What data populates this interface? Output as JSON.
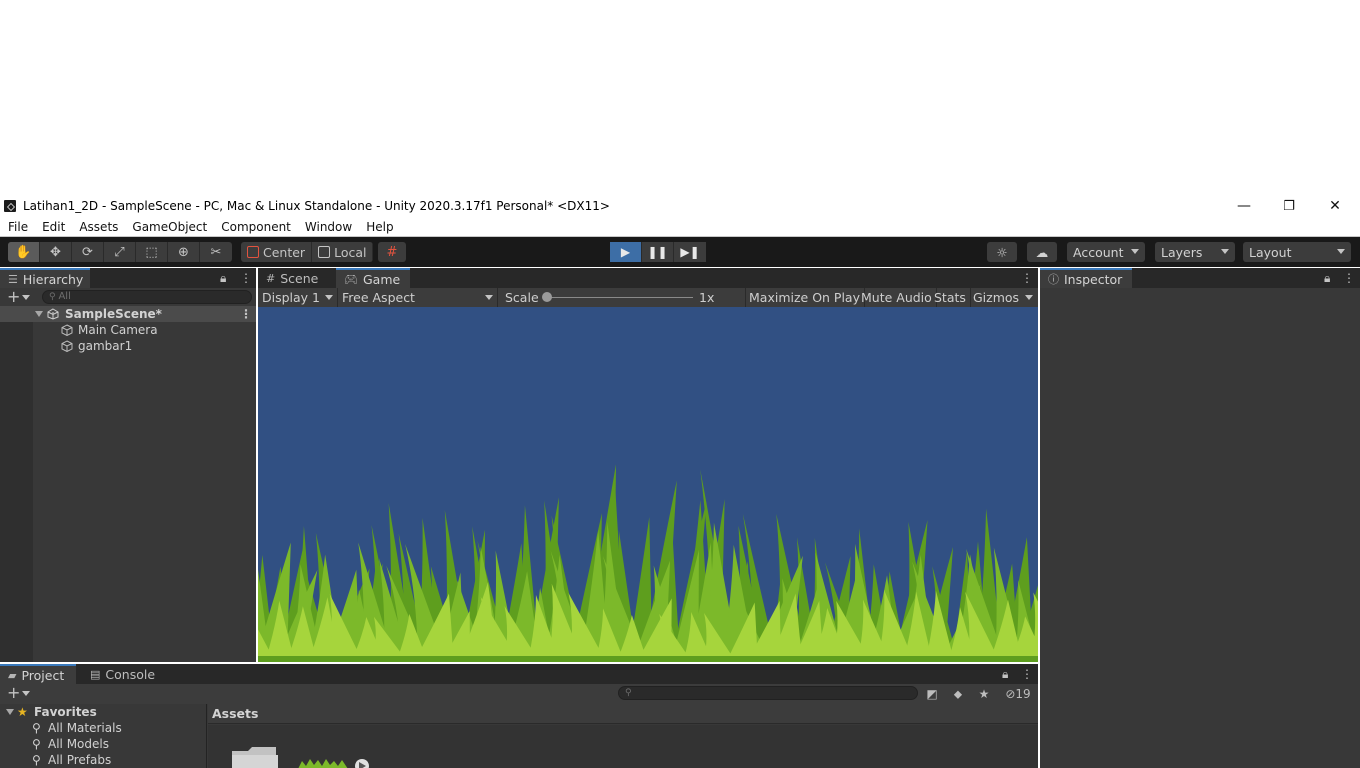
{
  "window": {
    "title": "Latihan1_2D - SampleScene - PC, Mac & Linux Standalone - Unity 2020.3.17f1 Personal* <DX11>",
    "minimize_glyph": "—",
    "restore_glyph": "❐",
    "close_glyph": "✕"
  },
  "menu": [
    "File",
    "Edit",
    "Assets",
    "GameObject",
    "Component",
    "Window",
    "Help"
  ],
  "toolbar": {
    "pivot_label": "Center",
    "space_label": "Local",
    "account_label": "Account",
    "layers_label": "Layers",
    "layout_label": "Layout",
    "play_state": "playing"
  },
  "hierarchy": {
    "tab_label": "Hierarchy",
    "search_placeholder": "All",
    "scene_label": "SampleScene*",
    "items": [
      "Main Camera",
      "gambar1"
    ]
  },
  "scene_tabs": {
    "scene_label": "Scene",
    "game_label": "Game"
  },
  "game_toolbar": {
    "display_label": "Display 1",
    "aspect_label": "Free Aspect",
    "scale_label": "Scale",
    "scale_value": "1x",
    "maximize_label": "Maximize On Play",
    "mute_label": "Mute Audio",
    "stats_label": "Stats",
    "gizmos_label": "Gizmos"
  },
  "game_view": {
    "background_color": "#315083",
    "grass_dark": "#5e9e1e",
    "grass_mid": "#7cb92a",
    "grass_light": "#a6d53c"
  },
  "inspector": {
    "tab_label": "Inspector"
  },
  "project": {
    "project_tab": "Project",
    "console_tab": "Console",
    "favorites_label": "Favorites",
    "favorites": [
      "All Materials",
      "All Models",
      "All Prefabs"
    ],
    "assets_header": "Assets",
    "hidden_count": "19"
  },
  "colors": {
    "accent_blue": "#3a79bb",
    "play_active": "#3d6ea6",
    "favorite_star": "#e6b422"
  }
}
